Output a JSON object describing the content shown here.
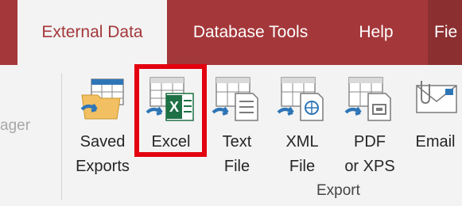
{
  "tabs": [
    {
      "label": "External Data",
      "active": true
    },
    {
      "label": "Database Tools",
      "active": false
    },
    {
      "label": "Help",
      "active": false
    },
    {
      "label": "Fie",
      "active": false
    }
  ],
  "previous_group_partial_label": "ager",
  "export_group": {
    "label": "Export",
    "commands": [
      {
        "label_line1": "Saved",
        "label_line2": "Exports",
        "icon": "saved-exports-icon"
      },
      {
        "label_line1": "Excel",
        "label_line2": "",
        "icon": "excel-icon",
        "highlighted": true
      },
      {
        "label_line1": "Text",
        "label_line2": "File",
        "icon": "text-file-icon"
      },
      {
        "label_line1": "XML",
        "label_line2": "File",
        "icon": "xml-file-icon"
      },
      {
        "label_line1": "PDF",
        "label_line2": "or XPS",
        "icon": "pdf-xps-icon"
      },
      {
        "label_line1": "Email",
        "label_line2": "",
        "icon": "email-icon"
      }
    ]
  },
  "colors": {
    "tab_bar": "#a4373a",
    "ribbon": "#f3f3f3",
    "highlight": "#e3000f",
    "excel_green": "#1e7145",
    "arrow_blue": "#2e75b6"
  }
}
